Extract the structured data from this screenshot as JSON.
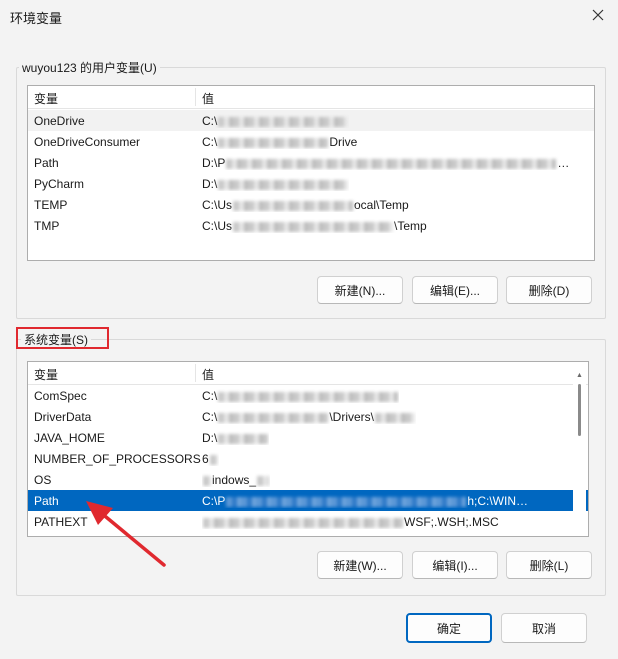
{
  "window": {
    "title": "环境变量"
  },
  "user_section": {
    "legend": "wuyou123 的用户变量(U)",
    "columns": [
      "变量",
      "值"
    ],
    "rows": [
      {
        "name": "OneDrive",
        "value_prefix": "C:\\",
        "value_suffix": ""
      },
      {
        "name": "OneDriveConsumer",
        "value_prefix": "C:\\",
        "value_suffix": "Drive"
      },
      {
        "name": "Path",
        "value_prefix": "D:\\P",
        "value_suffix": "…"
      },
      {
        "name": "PyCharm",
        "value_prefix": "D:\\",
        "value_suffix": ""
      },
      {
        "name": "TEMP",
        "value_prefix": "C:\\Us",
        "value_suffix": "ocal\\Temp"
      },
      {
        "name": "TMP",
        "value_prefix": "C:\\Us",
        "value_suffix": "\\Temp"
      }
    ],
    "buttons": {
      "new": "新建(N)...",
      "edit": "编辑(E)...",
      "delete": "删除(D)"
    }
  },
  "system_section": {
    "legend": "系统变量(S)",
    "columns": [
      "变量",
      "值"
    ],
    "rows": [
      {
        "name": "ComSpec",
        "value_prefix": "C:\\",
        "value_suffix": ""
      },
      {
        "name": "DriverData",
        "value_prefix": "C:\\",
        "value_suffix": "\\Drivers\\"
      },
      {
        "name": "JAVA_HOME",
        "value_prefix": "D:\\",
        "value_suffix": ""
      },
      {
        "name": "NUMBER_OF_PROCESSORS",
        "value_prefix": "6",
        "value_suffix": ""
      },
      {
        "name": "OS",
        "value_prefix": "",
        "value_suffix": "indows_"
      },
      {
        "name": "Path",
        "value_prefix": "C:\\P",
        "value_suffix": "h;C:\\WIN…"
      },
      {
        "name": "PATHEXT",
        "value_prefix": "",
        "value_suffix": "WSF;.WSH;.MSC"
      }
    ],
    "selected_row": "Path",
    "buttons": {
      "new": "新建(W)...",
      "edit": "编辑(I)...",
      "delete": "删除(L)"
    }
  },
  "footer": {
    "ok": "确定",
    "cancel": "取消"
  },
  "colors": {
    "selection": "#0067c0",
    "annotation": "#e0292f"
  },
  "icons": [
    "close-icon",
    "scroll-up-icon",
    "scroll-down-icon",
    "annotation-arrow-icon"
  ]
}
